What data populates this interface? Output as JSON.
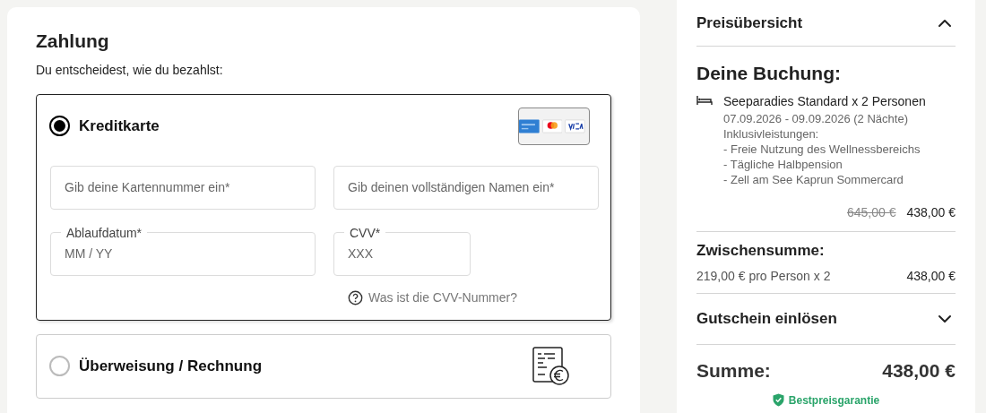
{
  "payment": {
    "title": "Zahlung",
    "subtitle": "Du entscheidest, wie du bezahlst:",
    "methods": [
      {
        "kind": "card",
        "label": "Kreditkarte",
        "selected": true,
        "fields": [
          {
            "kind": "wide",
            "placeholder": "Gib deine Kartennummer ein*"
          },
          {
            "kind": "wide",
            "placeholder": "Gib deinen vollständigen Namen ein*"
          },
          {
            "kind": "wide",
            "label": "Ablaufdatum*",
            "placeholder": "MM / YY"
          },
          {
            "kind": "narrow",
            "label": "CVV*",
            "placeholder": "XXX"
          }
        ],
        "help": "Was ist die CVV-Nummer?"
      },
      {
        "kind": "invoice",
        "label": "Überweisung / Rechnung",
        "selected": false
      }
    ]
  },
  "summary": {
    "title": "Preisübersicht",
    "expanded": true,
    "booking_title": "Deine Buchung:",
    "item": {
      "name": "Seeparadies Standard x 2 Personen",
      "lines": [
        "07.09.2026 - 09.09.2026 (2 Nächte)",
        "Inklusivleistungen:",
        "- Freie Nutzung des Wellnessbereichs",
        "- Tägliche Halbpension",
        "- Zell am See Kaprun Sommercard"
      ],
      "old_price": "645,00 €",
      "price": "438,00 €"
    },
    "subtotal": {
      "title": "Zwischensumme:",
      "detail": "219,00 € pro Person x 2",
      "amount": "438,00 €"
    },
    "voucher": {
      "title": "Gutschein einlösen",
      "expanded": false
    },
    "total": {
      "label": "Summe:",
      "amount": "438,00 €"
    },
    "badge": "Bestpreisgarantie"
  }
}
